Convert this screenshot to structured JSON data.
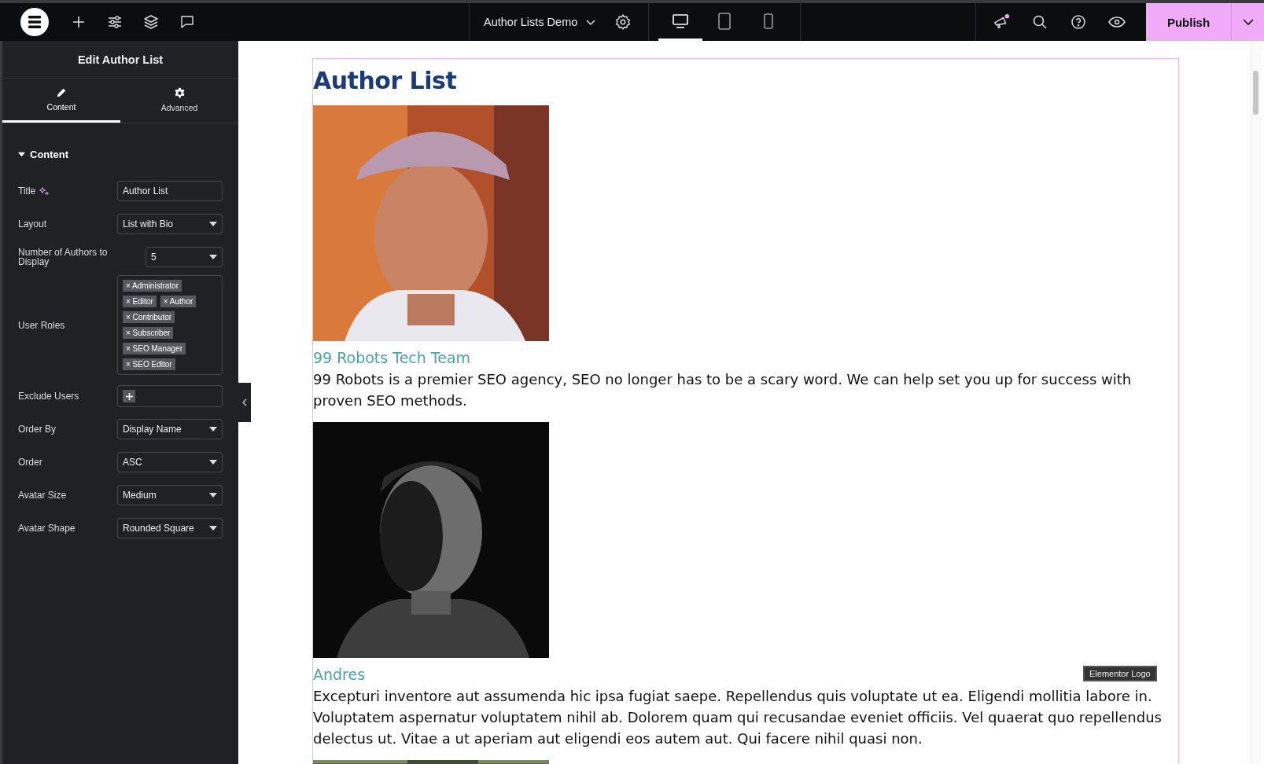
{
  "topbar": {
    "document_title": "Author Lists Demo",
    "devices": [
      {
        "kind": "desktop",
        "selected": true
      },
      {
        "kind": "tablet",
        "selected": false
      },
      {
        "kind": "mobile",
        "selected": false
      }
    ],
    "notification": true,
    "publish": "Publish"
  },
  "panel": {
    "title": "Edit Author List",
    "tabs": [
      {
        "label": "Content",
        "kind": "pencil",
        "selected": true
      },
      {
        "label": "Advanced",
        "kind": "gear",
        "selected": false
      }
    ],
    "section": {
      "title": "Content",
      "expanded": true
    },
    "controls": [
      {
        "kind": "text",
        "label": "Title",
        "ai": true,
        "value": "Author List"
      },
      {
        "kind": "select",
        "label": "Layout",
        "value": "List with Bio"
      },
      {
        "kind": "select",
        "label": "Number of Authors to Display",
        "value": "5",
        "narrow": true
      },
      {
        "kind": "tags",
        "label": "User Roles",
        "tags": [
          "× Administrator",
          "× Editor",
          "× Author",
          "× Contributor",
          "× Subscriber",
          "× SEO Manager",
          "× SEO Editor"
        ]
      },
      {
        "kind": "add",
        "label": "Exclude Users"
      },
      {
        "kind": "select",
        "label": "Order By",
        "value": "Display Name"
      },
      {
        "kind": "select",
        "label": "Order",
        "value": "ASC"
      },
      {
        "kind": "select",
        "label": "Avatar Size",
        "value": "Medium"
      },
      {
        "kind": "select",
        "label": "Avatar Shape",
        "value": "Rounded Square"
      }
    ]
  },
  "canvas": {
    "title": "Author List",
    "authors": [
      {
        "picture": {
          "kind": "picture"
        },
        "name": "99 Robots Tech Team",
        "bio": "99 Robots is a premier SEO agency, SEO no longer has to be a scary word. We can help set you up for success with proven SEO methods."
      },
      {
        "picture": {
          "kind": "picture"
        },
        "name": "Andres",
        "bio": "Excepturi inventore aut assumenda hic ipsa fugiat saepe. Repellendus quis voluptate ut ea. Eligendi mollitia labore in. Voluptatem aspernatur voluptatem nihil ab. Dolorem quam qui recusandae eveniet officiis. Vel quaerat quo repellendus delectus ut. Vitae a ut aperiam aut eligendi eos autem aut. Qui facere nihil quasi non."
      },
      {
        "picture": {
          "kind": "picture"
        }
      }
    ],
    "tooltip": "Elementor Logo"
  }
}
